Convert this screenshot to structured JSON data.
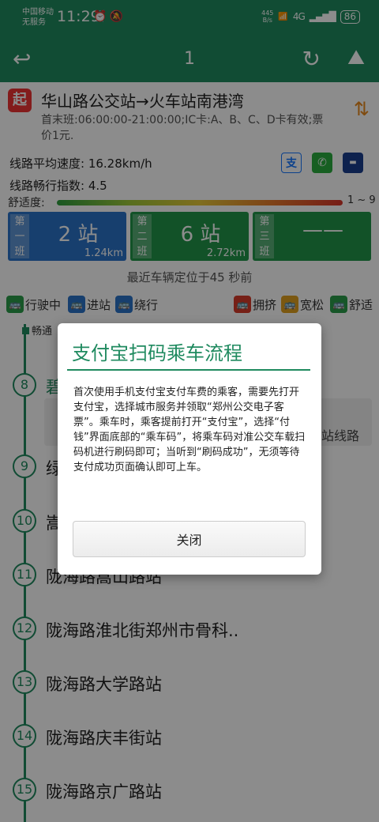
{
  "status": {
    "carrier_line1": "中国移动",
    "carrier_line2": "无服务",
    "time": "11:29",
    "speed_value": "445",
    "speed_unit": "B/s",
    "network": "4G",
    "battery": "86"
  },
  "toolbar": {
    "title": "1"
  },
  "route": {
    "start_badge": "起",
    "name": "华山路公交站→火车站南港湾",
    "info": "首末班:06:00:00-21:00:00;IC卡:A、B、C、D卡有效;票价1元.",
    "avg_speed": "线路平均速度: 16.28km/h",
    "smooth_index": "线路畅行指数: 4.5",
    "comfort_label": "舒适度:",
    "comfort_range": "1 ~ 9"
  },
  "buses": [
    {
      "side": "第一班",
      "stations": "2 站",
      "km": "1.24km",
      "color": "#2b73c9"
    },
    {
      "side": "第二班",
      "stations": "6 站",
      "km": "2.72km",
      "color": "#21964a"
    },
    {
      "side": "第三班",
      "stations": "——",
      "km": "",
      "color": "#21964a"
    }
  ],
  "last_position": "最近车辆定位于45 秒前",
  "legend": [
    {
      "label": "行驶中",
      "color": "#2a9d4a"
    },
    {
      "label": "进站",
      "color": "#2b73c9"
    },
    {
      "label": "绕行",
      "color": "#2b73c9"
    },
    {
      "label": "拥挤",
      "color": "#d83b2a"
    },
    {
      "label": "宽松",
      "color": "#e0a020"
    },
    {
      "label": "舒适",
      "color": "#2a9d4a"
    }
  ],
  "smooth_tag": "畅通",
  "stops": [
    {
      "num": "8",
      "name": "碧"
    },
    {
      "num": "9",
      "name": "绿"
    },
    {
      "num": "10",
      "name": "嵩"
    },
    {
      "num": "11",
      "name": "陇海路嵩山路站"
    },
    {
      "num": "12",
      "name": "陇海路淮北街郑州市骨科.."
    },
    {
      "num": "13",
      "name": "陇海路大学路站"
    },
    {
      "num": "14",
      "name": "陇海路庆丰街站"
    },
    {
      "num": "15",
      "name": "陇海路京广路站"
    }
  ],
  "chip_label": "站线路",
  "dialog": {
    "title": "支付宝扫码乘车流程",
    "body": "首次使用手机支付宝支付车费的乘客，需要先打开支付宝，选择城市服务并领取“郑州公交电子客票”。乘车时，乘客提前打开“支付宝”，选择“付钱”界面底部的“乘车码”，将乘车码对准公交车载扫码机进行刷码即可；当听到“刷码成功”，无须等待支付成功页面确认即可上车。",
    "close_label": "关闭"
  }
}
